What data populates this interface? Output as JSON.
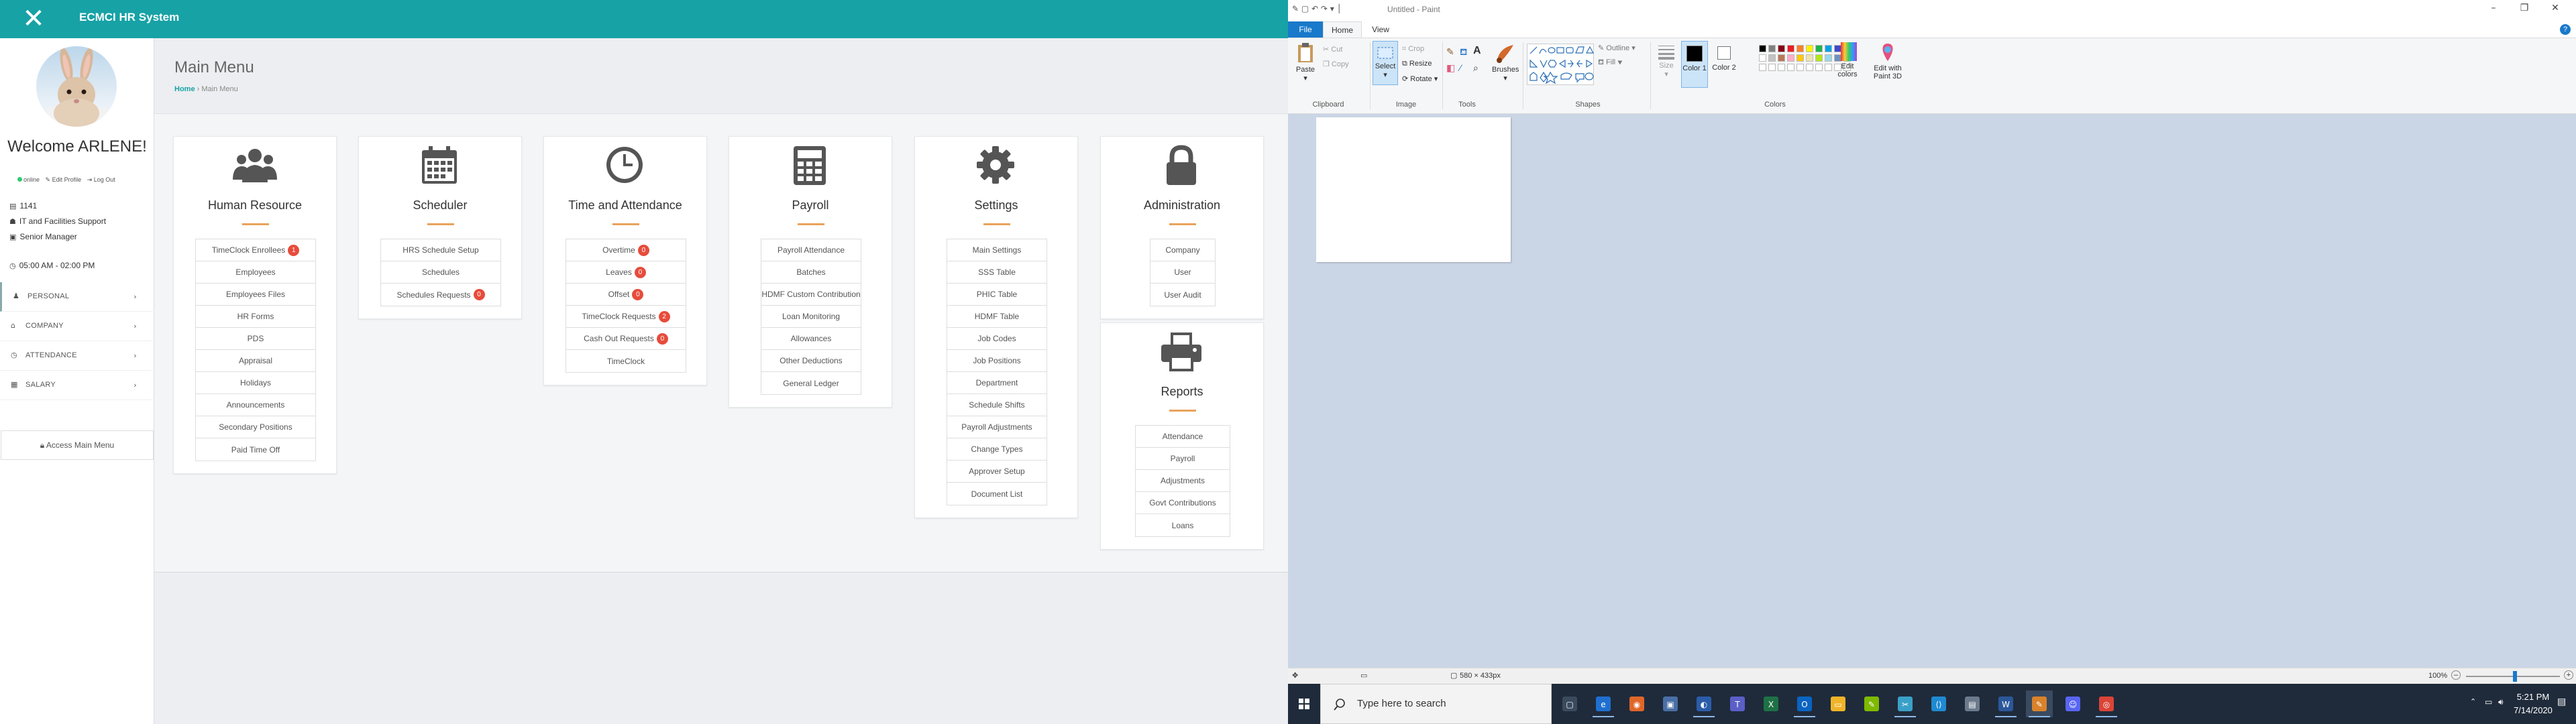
{
  "hr": {
    "brand": "ECMCI HR System",
    "welcome": "Welcome ARLENE!",
    "status": {
      "online": "online",
      "edit_profile": "Edit Profile",
      "logout": "Log Out"
    },
    "info": {
      "id": "1141",
      "department": "IT and Facilities Support",
      "position": "Senior Manager",
      "schedule": "05:00 AM - 02:00 PM"
    },
    "nav": [
      "PERSONAL",
      "COMPANY",
      "ATTENDANCE",
      "SALARY"
    ],
    "access_main_menu": "Access Main Menu",
    "page_title": "Main Menu",
    "breadcrumb": {
      "home": "Home",
      "sep": "›",
      "current": "Main Menu"
    },
    "cards": [
      {
        "icon": "users-icon",
        "title": "Human Resource",
        "links": [
          {
            "label": "TimeClock Enrollees",
            "badge": "1"
          },
          {
            "label": "Employees"
          },
          {
            "label": "Employees Files"
          },
          {
            "label": "HR Forms"
          },
          {
            "label": "PDS"
          },
          {
            "label": "Appraisal"
          },
          {
            "label": "Holidays"
          },
          {
            "label": "Announcements"
          },
          {
            "label": "Secondary Positions"
          },
          {
            "label": "Paid Time Off"
          }
        ]
      },
      {
        "icon": "calendar-icon",
        "title": "Scheduler",
        "links": [
          {
            "label": "HRS Schedule Setup"
          },
          {
            "label": "Schedules"
          },
          {
            "label": "Schedules Requests",
            "badge": "0"
          }
        ]
      },
      {
        "icon": "clock-icon",
        "title": "Time and Attendance",
        "links": [
          {
            "label": "Overtime",
            "badge": "0"
          },
          {
            "label": "Leaves",
            "badge": "0"
          },
          {
            "label": "Offset",
            "badge": "0"
          },
          {
            "label": "TimeClock Requests",
            "badge": "2"
          },
          {
            "label": "Cash Out Requests",
            "badge": "0"
          },
          {
            "label": "TimeClock"
          }
        ]
      },
      {
        "icon": "calculator-icon",
        "title": "Payroll",
        "links": [
          {
            "label": "Payroll Attendance"
          },
          {
            "label": "Batches"
          },
          {
            "label": "HDMF Custom Contribution"
          },
          {
            "label": "Loan Monitoring"
          },
          {
            "label": "Allowances"
          },
          {
            "label": "Other Deductions"
          },
          {
            "label": "General Ledger"
          }
        ]
      },
      {
        "icon": "gear-icon",
        "title": "Settings",
        "links": [
          {
            "label": "Main Settings"
          },
          {
            "label": "SSS Table"
          },
          {
            "label": "PHIC Table"
          },
          {
            "label": "HDMF Table"
          },
          {
            "label": "Job Codes"
          },
          {
            "label": "Job Positions"
          },
          {
            "label": "Department"
          },
          {
            "label": "Schedule Shifts"
          },
          {
            "label": "Payroll Adjustments"
          },
          {
            "label": "Change Types"
          },
          {
            "label": "Approver Setup"
          },
          {
            "label": "Document List"
          }
        ]
      },
      {
        "icon": "lock-icon",
        "title": "Administration",
        "links": [
          {
            "label": "Company"
          },
          {
            "label": "User"
          },
          {
            "label": "User Audit"
          }
        ]
      },
      {
        "icon": "printer-icon",
        "title": "Reports",
        "links": [
          {
            "label": "Attendance"
          },
          {
            "label": "Payroll"
          },
          {
            "label": "Adjustments"
          },
          {
            "label": "Govt Contributions"
          },
          {
            "label": "Loans"
          }
        ]
      }
    ]
  },
  "paint": {
    "title": "Untitled - Paint",
    "tabs": [
      "File",
      "Home",
      "View"
    ],
    "help": "?",
    "groups": [
      "Clipboard",
      "Image",
      "Tools",
      "Shapes",
      "Colors"
    ],
    "buttons": {
      "paste": "Paste",
      "cut": "Cut",
      "copy": "Copy",
      "select": "Select",
      "crop": "Crop",
      "resize": "Resize",
      "rotate": "Rotate",
      "brushes": "Brushes",
      "outline": "Outline",
      "fill": "Fill",
      "size": "Size",
      "color1": "Color 1",
      "color2": "Color 2",
      "edit_colors": "Edit colors",
      "edit_paint3d": "Edit with Paint 3D"
    },
    "palette_row1": [
      "#000000",
      "#7f7f7f",
      "#880015",
      "#ed1c24",
      "#ff7f27",
      "#fff200",
      "#22b14c",
      "#00a2e8",
      "#3f48cc",
      "#a349a4"
    ],
    "palette_row2": [
      "#ffffff",
      "#c3c3c3",
      "#b97a57",
      "#ffaec9",
      "#ffc90e",
      "#efe4b0",
      "#b5e61d",
      "#99d9ea",
      "#7092be",
      "#c8bfe7"
    ],
    "status": {
      "dimensions": "580 × 433px",
      "zoom": "100%"
    }
  },
  "taskbar": {
    "search_placeholder": "Type here to search",
    "time": "5:21 PM",
    "date": "7/14/2020"
  }
}
